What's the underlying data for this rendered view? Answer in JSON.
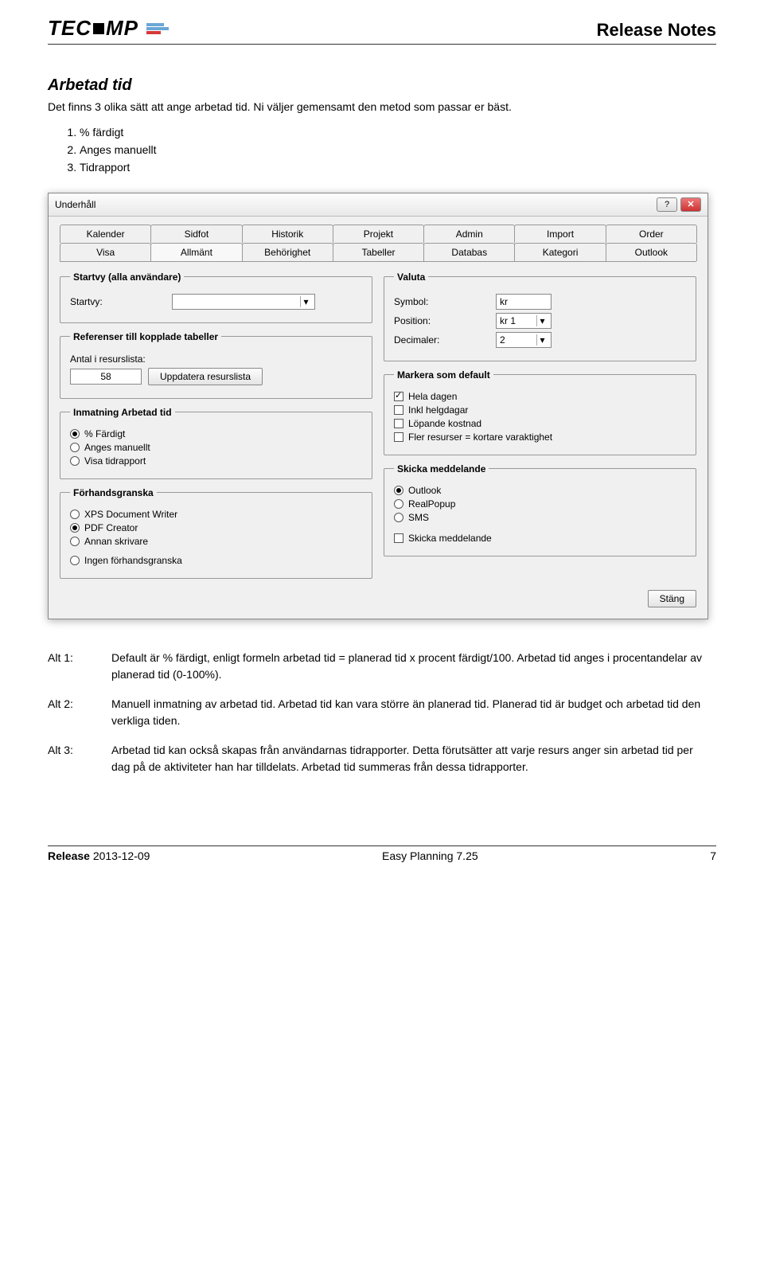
{
  "header": {
    "logo_text_1": "TEC",
    "logo_text_2": "MP",
    "title": "Release Notes"
  },
  "section": {
    "title": "Arbetad tid",
    "intro": "Det finns 3 olika sätt att ange arbetad tid. Ni väljer gemensamt den metod som passar er bäst.",
    "methods": [
      "% färdigt",
      "Anges manuellt",
      "Tidrapport"
    ]
  },
  "dialog": {
    "title": "Underhåll",
    "tabs_row1": [
      "Kalender",
      "Sidfot",
      "Historik",
      "Projekt",
      "Admin",
      "Import",
      "Order"
    ],
    "tabs_row2": [
      "Visa",
      "Allmänt",
      "Behörighet",
      "Tabeller",
      "Databas",
      "Kategori",
      "Outlook"
    ],
    "active_tab": "Allmänt",
    "startvy": {
      "legend": "Startvy (alla användare)",
      "label": "Startvy:",
      "value": ""
    },
    "refs": {
      "legend": "Referenser till kopplade tabeller",
      "label": "Antal i resurslista:",
      "value": "58",
      "button": "Uppdatera resurslista"
    },
    "inmatning": {
      "legend": "Inmatning Arbetad tid",
      "options": [
        "% Färdigt",
        "Anges manuellt",
        "Visa tidrapport"
      ],
      "selected": 0
    },
    "forhand": {
      "legend": "Förhandsgranska",
      "options": [
        "XPS Document Writer",
        "PDF Creator",
        "Annan skrivare",
        "Ingen förhandsgranska"
      ],
      "selected": 1
    },
    "valuta": {
      "legend": "Valuta",
      "symbol_label": "Symbol:",
      "symbol_value": "kr",
      "position_label": "Position:",
      "position_value": "kr 1",
      "decimal_label": "Decimaler:",
      "decimal_value": "2"
    },
    "markera": {
      "legend": "Markera som default",
      "options": [
        {
          "label": "Hela dagen",
          "checked": true
        },
        {
          "label": "Inkl helgdagar",
          "checked": false
        },
        {
          "label": "Löpande kostnad",
          "checked": false
        },
        {
          "label": "Fler resurser = kortare varaktighet",
          "checked": false
        }
      ]
    },
    "skicka": {
      "legend": "Skicka meddelande",
      "radios": [
        "Outlook",
        "RealPopup",
        "SMS"
      ],
      "selected": 0,
      "check_label": "Skicka meddelande",
      "check_checked": false
    },
    "close_button": "Stäng"
  },
  "alts": [
    {
      "key": "Alt 1:",
      "text": "Default är % färdigt, enligt formeln arbetad tid = planerad tid x procent färdigt/100. Arbetad tid anges i procentandelar av planerad tid (0-100%)."
    },
    {
      "key": "Alt 2:",
      "text": "Manuell inmatning av arbetad tid. Arbetad tid kan vara större än planerad tid. Planerad tid är budget och arbetad tid den verkliga tiden."
    },
    {
      "key": "Alt 3:",
      "text": "Arbetad tid kan också skapas från användarnas tidrapporter. Detta förutsätter att varje resurs anger sin arbetad tid per dag på de aktiviteter han har tilldelats. Arbetad tid summeras från dessa tidrapporter."
    }
  ],
  "footer": {
    "release_label": "Release",
    "release_date": "2013-12-09",
    "product": "Easy Planning 7.25",
    "page": "7"
  }
}
